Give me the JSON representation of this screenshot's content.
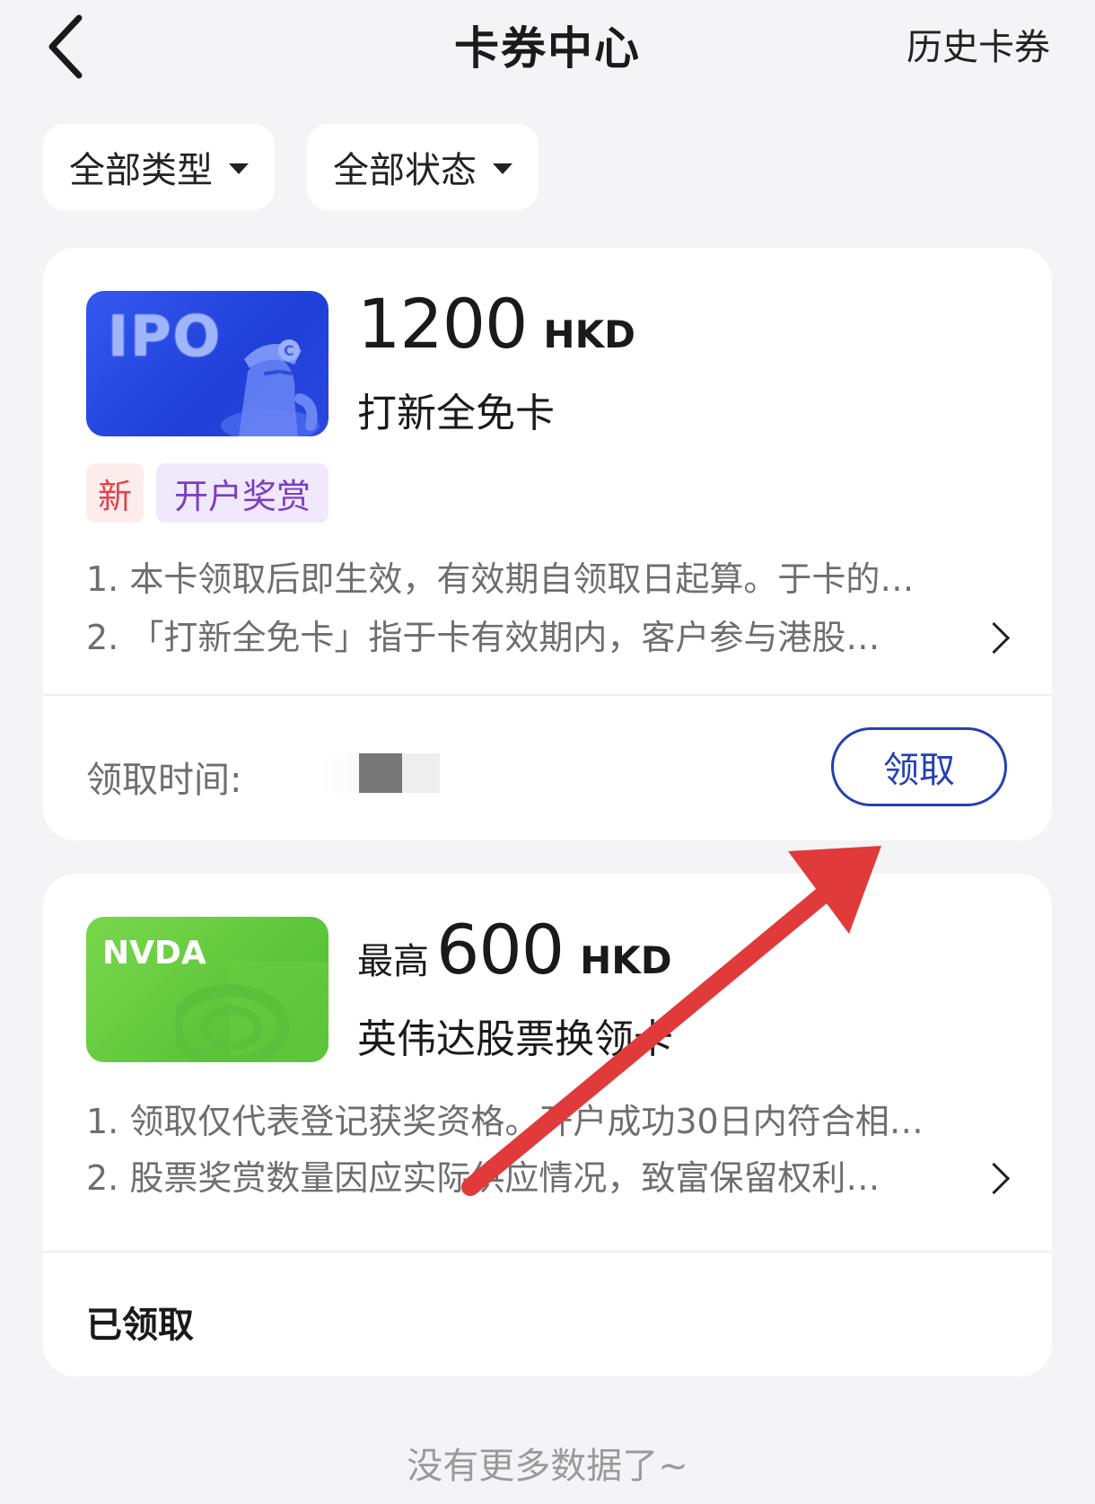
{
  "header": {
    "title": "卡券中心",
    "history_label": "历史卡券",
    "back_icon": "chevron-left-icon"
  },
  "filters": [
    {
      "label": "全部类型"
    },
    {
      "label": "全部状态"
    }
  ],
  "cards": [
    {
      "thumb_text": "IPO",
      "amount": "1200",
      "amount_prefix": "",
      "unit": "HKD",
      "name": "打新全免卡",
      "tags": [
        "新",
        "开户奖赏"
      ],
      "desc": [
        "1. 本卡领取后即生效，有效期自领取日起算。于卡的…",
        "2. 「打新全免卡」指于卡有效期内，客户参与港股…"
      ],
      "claim_time_label": "领取时间: ",
      "action_label": "领取"
    },
    {
      "thumb_text": "NVDA",
      "amount": "600",
      "amount_prefix": "最高",
      "unit": "HKD",
      "name": "英伟达股票换领卡",
      "desc": [
        "1. 领取仅代表登记获奖资格。开户成功30日内符合相…",
        "2. 股票奖赏数量因应实际供应情况，致富保留权利…"
      ],
      "status": "已领取"
    }
  ],
  "footer_text": "没有更多数据了~",
  "colors": {
    "accent": "#2440b3",
    "arrow": "#e03a3a",
    "tag_new": "#e0444c",
    "tag_reward": "#7a3ec2"
  }
}
